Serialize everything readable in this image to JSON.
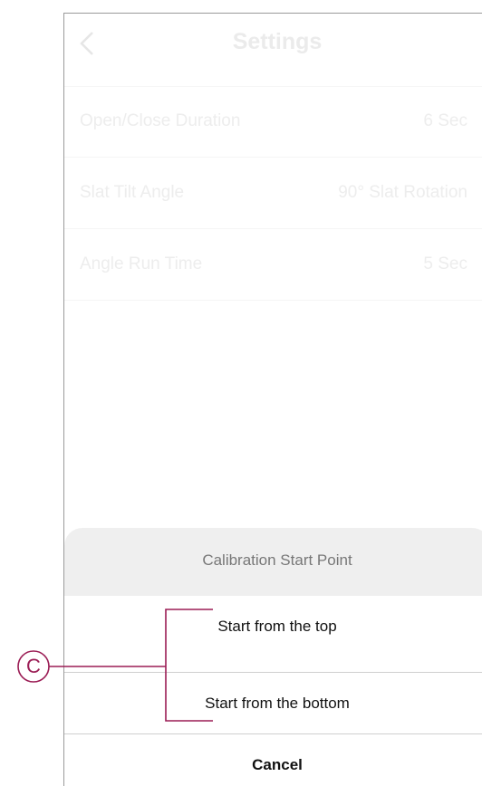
{
  "header": {
    "title": "Settings",
    "back_icon": "chevron-left-icon"
  },
  "settings": [
    {
      "label": "Open/Close Duration",
      "value": "6 Sec"
    },
    {
      "label": "Slat Tilt Angle",
      "value": "90° Slat Rotation"
    },
    {
      "label": "Angle Run Time",
      "value": "5 Sec"
    }
  ],
  "action_sheet": {
    "title": "Calibration Start Point",
    "options": [
      {
        "label": "Start from the top"
      },
      {
        "label": "Start from the bottom"
      }
    ],
    "cancel_label": "Cancel"
  },
  "annotation": {
    "letter": "C",
    "color": "#9b1d55"
  }
}
